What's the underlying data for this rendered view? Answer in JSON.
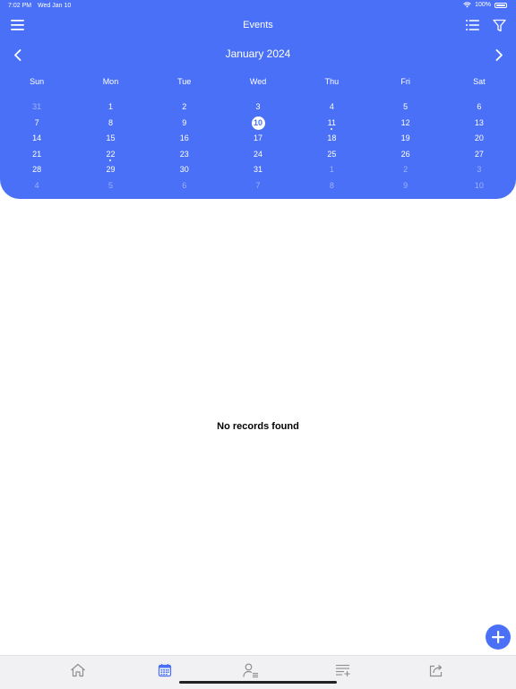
{
  "status": {
    "time": "7:02 PM",
    "date": "Wed Jan 10",
    "battery": "100%"
  },
  "nav": {
    "title": "Events",
    "menu_icon": "hamburger-menu-icon",
    "list_icon": "list-view-icon",
    "filter_icon": "filter-icon"
  },
  "calendar": {
    "month_label": "January 2024",
    "prev_icon": "chevron-left-icon",
    "next_icon": "chevron-right-icon",
    "weekdays": [
      "Sun",
      "Mon",
      "Tue",
      "Wed",
      "Thu",
      "Fri",
      "Sat"
    ],
    "weeks": [
      [
        {
          "d": "31",
          "m": true
        },
        {
          "d": "1"
        },
        {
          "d": "2"
        },
        {
          "d": "3"
        },
        {
          "d": "4"
        },
        {
          "d": "5"
        },
        {
          "d": "6"
        }
      ],
      [
        {
          "d": "7"
        },
        {
          "d": "8"
        },
        {
          "d": "9"
        },
        {
          "d": "10",
          "today": true
        },
        {
          "d": "11",
          "dot": true
        },
        {
          "d": "12"
        },
        {
          "d": "13"
        }
      ],
      [
        {
          "d": "14"
        },
        {
          "d": "15"
        },
        {
          "d": "16"
        },
        {
          "d": "17"
        },
        {
          "d": "18"
        },
        {
          "d": "19"
        },
        {
          "d": "20"
        }
      ],
      [
        {
          "d": "21"
        },
        {
          "d": "22",
          "dot": true
        },
        {
          "d": "23"
        },
        {
          "d": "24"
        },
        {
          "d": "25"
        },
        {
          "d": "26"
        },
        {
          "d": "27"
        }
      ],
      [
        {
          "d": "28"
        },
        {
          "d": "29"
        },
        {
          "d": "30"
        },
        {
          "d": "31"
        },
        {
          "d": "1",
          "m": true
        },
        {
          "d": "2",
          "m": true
        },
        {
          "d": "3",
          "m": true
        }
      ],
      [
        {
          "d": "4",
          "m": true
        },
        {
          "d": "5",
          "m": true
        },
        {
          "d": "6",
          "m": true
        },
        {
          "d": "7",
          "m": true
        },
        {
          "d": "8",
          "m": true
        },
        {
          "d": "9",
          "m": true
        },
        {
          "d": "10",
          "m": true
        }
      ]
    ]
  },
  "main": {
    "empty_message": "No records found"
  },
  "fab": {
    "icon": "plus-icon"
  },
  "tabbar": {
    "tabs": [
      {
        "icon": "home-icon"
      },
      {
        "icon": "calendar-icon",
        "active": true
      },
      {
        "icon": "contacts-list-icon"
      },
      {
        "icon": "add-to-list-icon"
      },
      {
        "icon": "share-icon"
      }
    ]
  },
  "colors": {
    "accent": "#4a70f7",
    "tab_inactive": "#8e8e93",
    "tabbar_bg": "#f1f1f3"
  }
}
